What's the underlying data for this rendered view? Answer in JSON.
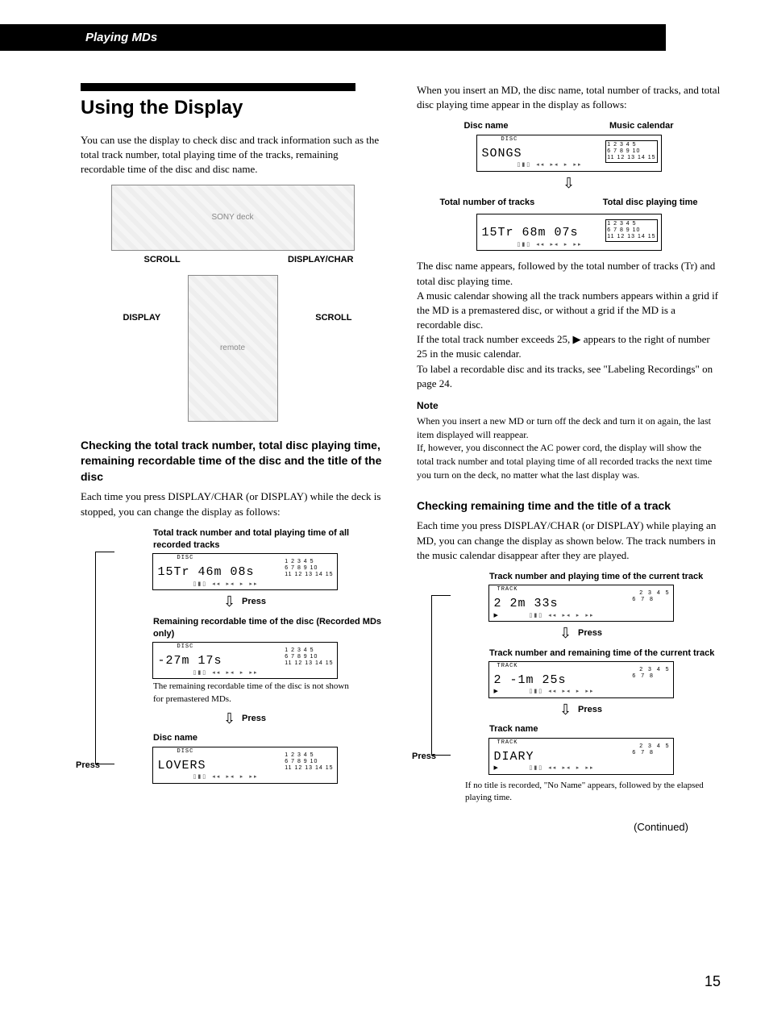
{
  "header": "Playing MDs",
  "title": "Using the Display",
  "intro": "You can use the display to check disc and track information such as the total track number, total playing time of the tracks, remaining recordable time of the disc and disc name.",
  "device": {
    "scroll": "SCROLL",
    "displaychar": "DISPLAY/CHAR",
    "display": "DISPLAY"
  },
  "section1": {
    "heading": "Checking the total track number, total disc playing time, remaining recordable time of the disc and the title of the disc",
    "body": "Each time you press DISPLAY/CHAR (or DISPLAY) while the deck is stopped, you can change the display as follows:",
    "label1": "Total track number and total playing time of all recorded tracks",
    "lcd1": "15Tr   46m  08s",
    "cal1a": "1  2  3  4  5",
    "cal1b": "6  7  8  9 10",
    "cal1c": "11 12 13 14 15",
    "press": "Press",
    "label2": "Remaining recordable time of the disc (Recorded MDs only)",
    "lcd2": "     -27m  17s",
    "note2": "The remaining recordable time of the disc is not shown for premastered MDs.",
    "label3": "Disc name",
    "lcd3": "LOVERS",
    "leftpress": "Press"
  },
  "right_intro": "When you insert an MD, the disc name, total number of tracks, and total disc playing time appear in the display as follows:",
  "toplabels": {
    "left": "Disc name",
    "right": "Music calendar"
  },
  "lcd_top": "SONGS",
  "botlabels": {
    "left": "Total number of tracks",
    "right": "Total disc playing time"
  },
  "lcd_bot": "15Tr   68m  07s",
  "right_para": "The disc name appears, followed by the total number of tracks (Tr) and total disc playing time.\nA music calendar showing all the track numbers appears within a grid if the MD is a premastered disc, or without a grid if the MD is a recordable disc.\nIf the total track number exceeds 25, ▶ appears to the right of number 25 in the music calendar.\nTo label a recordable disc and its tracks, see \"Labeling Recordings\" on page 24.",
  "note_title": "Note",
  "note_body": "When you insert a new MD or turn off the deck and turn it on again, the last item displayed will reappear.\nIf, however, you disconnect the AC power cord, the display will show the total track number and total playing time of all recorded tracks the next time you turn on the deck, no matter what the last display was.",
  "section2": {
    "heading": "Checking remaining time and the title of a track",
    "body": "Each time you press DISPLAY/CHAR (or DISPLAY) while playing an MD, you can change the display as shown below.  The track numbers in the music calendar disappear after they are played.",
    "label1": "Track number and playing time of the current track",
    "lcd1": "2       2m  33s",
    "cal": "   2  3  4  5\n6  7  8",
    "press": "Press",
    "label2": "Track number and remaining time of the current track",
    "lcd2": "2      -1m  25s",
    "label3": "Track name",
    "lcd3": "DIARY",
    "leftpress": "Press",
    "footnote": "If no title is recorded, \"No Name\" appears, followed by the elapsed playing time."
  },
  "continued": "(Continued)",
  "pagenum": "15"
}
